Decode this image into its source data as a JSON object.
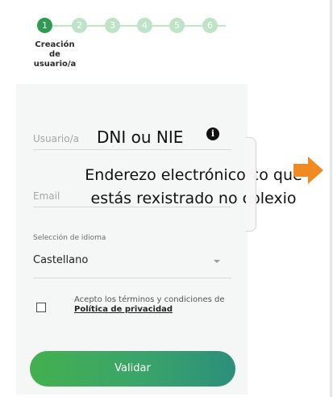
{
  "stepper": {
    "steps": [
      "1",
      "2",
      "3",
      "4",
      "5",
      "6"
    ],
    "active_label": "Creación de usuario/a"
  },
  "form": {
    "username": {
      "placeholder": "Usuario/a",
      "overlay_hint": "DNI ou NIE"
    },
    "email": {
      "placeholder": "Email",
      "overlay_hint": "Enderezo electrónico co que estás rexistrado no colexio"
    },
    "language": {
      "label": "Selección de idioma",
      "value": "Castellano"
    },
    "terms": {
      "text": "Acepto los términos y condiciones de ",
      "link": "Política de privacidad",
      "checked": false
    },
    "submit_label": "Validar"
  },
  "colors": {
    "accent": "#2f9a52",
    "step_inactive": "#bfe3c6",
    "button_start": "#43b04f",
    "button_end": "#2b8f7b",
    "arrow": "#f28a22"
  },
  "icons": {
    "info": "info-icon",
    "arrow": "arrow-right-icon",
    "chevron": "chevron-down-icon"
  }
}
